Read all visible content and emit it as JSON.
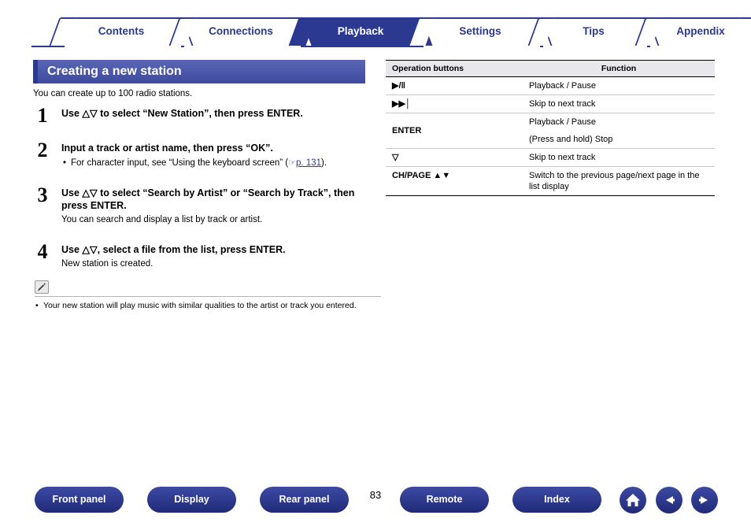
{
  "tabs": [
    {
      "label": "Contents",
      "active": false
    },
    {
      "label": "Connections",
      "active": false
    },
    {
      "label": "Playback",
      "active": true
    },
    {
      "label": "Settings",
      "active": false
    },
    {
      "label": "Tips",
      "active": false
    },
    {
      "label": "Appendix",
      "active": false
    }
  ],
  "section": {
    "title": "Creating a new station",
    "intro": "You can create up to 100 radio stations."
  },
  "steps": [
    {
      "num": "1",
      "head": "Use △▽ to select “New Station”, then press ENTER.",
      "sub": "",
      "bullets": []
    },
    {
      "num": "2",
      "head": "Input a track or artist name, then press “OK”.",
      "sub": "",
      "bullets": [
        {
          "text_before": "For character input, see “Using the keyboard screen” (",
          "arrow": "☞",
          "link": "p. 131",
          "text_after": ")."
        }
      ]
    },
    {
      "num": "3",
      "head": "Use △▽ to select “Search by Artist” or “Search by Track”, then press ENTER.",
      "sub": "You can search and display a list by track or artist.",
      "bullets": []
    },
    {
      "num": "4",
      "head": "Use △▽, select a file from the list, press ENTER.",
      "sub": "New station is created.",
      "bullets": []
    }
  ],
  "note": {
    "icon": "pencil-note-icon",
    "items": [
      "Your new station will play music with similar qualities to the artist or track you entered."
    ]
  },
  "table": {
    "headers": [
      "Operation buttons",
      "Function"
    ],
    "rows": [
      {
        "key": "▶/‖",
        "func": "Playback / Pause",
        "divider": true
      },
      {
        "key": "▶▶│",
        "func": "Skip to next track",
        "divider": true
      },
      {
        "key": "ENTER",
        "func": "Playback / Pause",
        "divider": false
      },
      {
        "key": "",
        "func": "(Press and hold) Stop",
        "divider": true
      },
      {
        "key": "▽",
        "func": "Skip to next track",
        "divider": true
      },
      {
        "key": "CH/PAGE ▲▼",
        "func": "Switch to the previous page/next page in the list display",
        "divider": true
      }
    ]
  },
  "footer": {
    "buttons": [
      {
        "label": "Front panel"
      },
      {
        "label": "Display"
      },
      {
        "label": "Rear panel"
      },
      {
        "label": "Remote"
      },
      {
        "label": "Index"
      }
    ],
    "page_number": "83",
    "icons": [
      {
        "name": "home-icon"
      },
      {
        "name": "back-arrow-icon"
      },
      {
        "name": "forward-arrow-icon"
      }
    ]
  }
}
